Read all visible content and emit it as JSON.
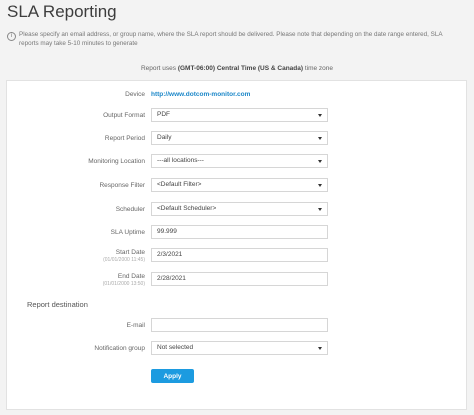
{
  "page_title": "SLA Reporting",
  "info_text": "Please specify an email address, or group name, where the SLA report should be delivered. Please note that depending on the date range entered, SLA reports may take 5-10 minutes to generate",
  "timezone": {
    "prefix": "Report uses ",
    "zone": "(GMT-06:00) Central Time (US & Canada)",
    "suffix": " time zone"
  },
  "form": {
    "device_label": "Device",
    "device_value": "http://www.dotcom-monitor.com",
    "output_format_label": "Output Format",
    "output_format_value": "PDF",
    "report_period_label": "Report Period",
    "report_period_value": "Daily",
    "monitoring_location_label": "Monitoring Location",
    "monitoring_location_value": "---all locations---",
    "response_filter_label": "Response Filter",
    "response_filter_value": "<Default Filter>",
    "scheduler_label": "Scheduler",
    "scheduler_value": "<Default Scheduler>",
    "sla_uptime_label": "SLA Uptime",
    "sla_uptime_value": "99.999",
    "start_date_label": "Start Date",
    "start_date_hint": "(01/01/2000 11:45)",
    "start_date_value": "2/3/2021",
    "end_date_label": "End Date",
    "end_date_hint": "(01/01/2000 13:50)",
    "end_date_value": "2/28/2021"
  },
  "destination": {
    "title": "Report destination",
    "email_label": "E-mail",
    "email_value": "",
    "notification_group_label": "Notification group",
    "notification_group_value": "Not selected"
  },
  "apply_label": "Apply",
  "colors": {
    "accent": "#1c9be0",
    "link": "#1a86c8",
    "background": "#f3f3f3"
  }
}
